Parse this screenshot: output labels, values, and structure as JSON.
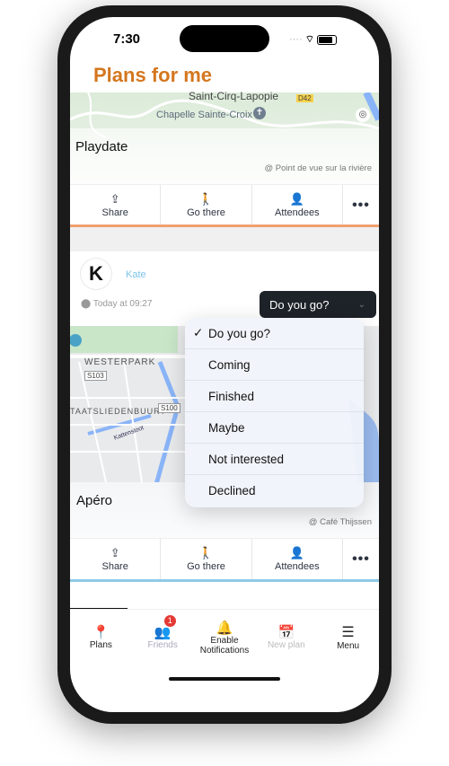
{
  "status": {
    "time": "7:30"
  },
  "header": {
    "title": "Plans for me"
  },
  "cards": [
    {
      "title": "Playdate",
      "attribution": "@ Point de vue sur la rivière",
      "map_labels": [
        "Saint-Cirq-Lapopie",
        "D42",
        "Chapelle Sainte-Croix"
      ],
      "accent": "#f0a070"
    },
    {
      "author": "Kate",
      "author_initial": "K",
      "time": "Today at 09:27",
      "title": "Apéro",
      "attribution": "@ Café Thijssen",
      "map_labels": [
        "WESTERPARK",
        "S103",
        "TAATSLIEDENBUURT",
        "S100",
        "Kattensloot"
      ],
      "accent": "#8ecae6",
      "rsvp": {
        "selected": "Do you go?",
        "options": [
          "Do you go?",
          "Coming",
          "Finished",
          "Maybe",
          "Not interested",
          "Declined"
        ]
      }
    }
  ],
  "actions": {
    "share": "Share",
    "go_there": "Go there",
    "attendees": "Attendees",
    "more": "•••"
  },
  "tabs": [
    {
      "label": "Plans",
      "icon": "map-pin-icon",
      "active": true
    },
    {
      "label": "Friends",
      "icon": "friends-icon",
      "badge": "1"
    },
    {
      "label": "Enable Notifications",
      "icon": "bell-icon"
    },
    {
      "label": "New plan",
      "icon": "calendar-icon"
    },
    {
      "label": "Menu",
      "icon": "hamburger-icon"
    }
  ],
  "colors": {
    "title": "#d4771f",
    "author": "#7cc3e8",
    "badge": "#e53935",
    "dropdown": "#1e2329"
  }
}
